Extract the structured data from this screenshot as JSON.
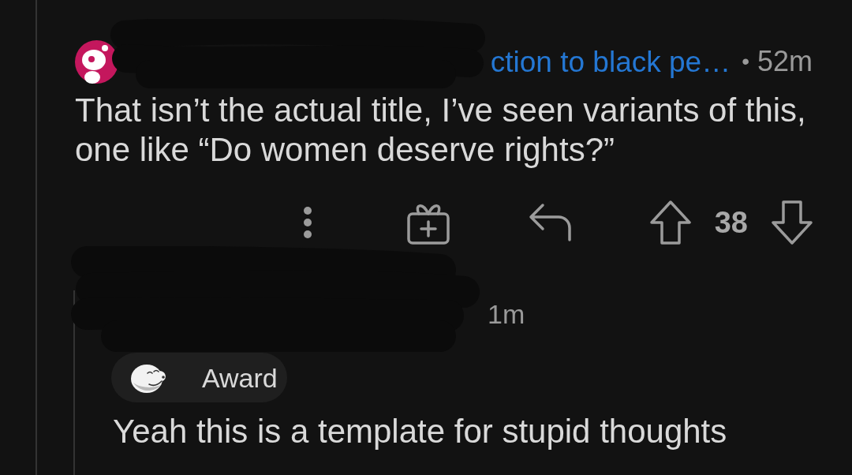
{
  "comment": {
    "header_link": "ction to black pe…",
    "separator": "•",
    "age": "52m",
    "body": "That isn’t the actual title, I’ve seen variants of this, one like “Do women deserve rights?”",
    "vote_count": "38",
    "replies": [
      {
        "age": "1m",
        "award": {
          "label": "Award"
        },
        "body": "Yeah this is a template for stupid thoughts"
      }
    ]
  }
}
